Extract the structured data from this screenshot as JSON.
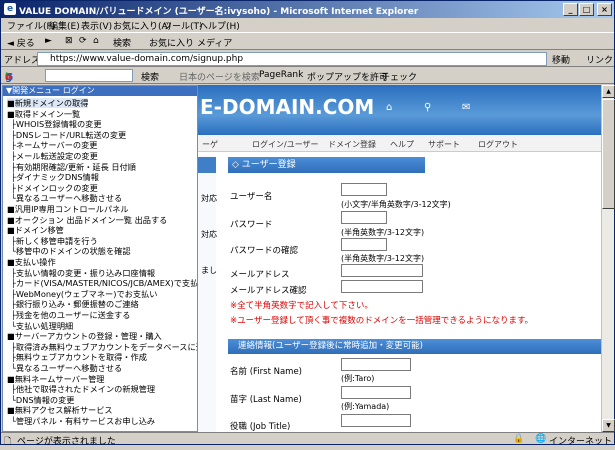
{
  "window": {
    "title": "VALUE DOMAIN/バリュードメイン (ユーザー名:ivysoho) - Microsoft Internet Explorer",
    "buttons": [
      "_",
      "□",
      "×"
    ]
  },
  "menubar": [
    "ファイル(F)",
    "編集(E)",
    "表示(V)",
    "お気に入り(A)",
    "ツール(T)",
    "ヘルプ(H)"
  ],
  "toolbar": [
    "◄ 戻る",
    "►",
    "⊠",
    "⟳",
    "⌂",
    "検索",
    "お気に入り",
    "メディア"
  ],
  "address": {
    "label": "アドレス(D)",
    "url": "https://www.value-domain.com/signup.php",
    "go": "移動",
    "links": "リンク"
  },
  "googlebar": {
    "logo": "Google -",
    "search": "検索",
    "items": [
      "日本のページを検索",
      "PageRank",
      "ポップアップを許可",
      "チェック"
    ]
  },
  "site": {
    "brand": "E-DOMAIN.COM",
    "nav": [
      "ログイン/ユーザー",
      "ドメイン登録",
      "ヘルプ",
      "サポート",
      "ログアウト"
    ],
    "nav_partial": "ーゲ",
    "strip_fragments": [
      "対応",
      "対応",
      "まし"
    ]
  },
  "form": {
    "section_title": "◇ ユーザー登録",
    "fields": [
      {
        "label": "ユーザー名",
        "hint": "(小文字/半角英数字/3-12文字)"
      },
      {
        "label": "パスワード",
        "hint": "(半角英数字/3-12文字)"
      },
      {
        "label": "パスワードの確認",
        "hint": "(半角英数字/3-12文字)"
      },
      {
        "label": "メールアドレス",
        "hint": ""
      },
      {
        "label": "メールアドレス確認",
        "hint": ""
      }
    ],
    "notes": [
      "※全て半角英数字で記入して下さい。",
      "※ユーザー登録して頂く事で複数のドメインを一括管理できるようになります。"
    ],
    "contact_title": "連絡情報(ユーザー登録後に常時追加・変更可能)",
    "contact_fields": [
      {
        "label": "名前 (First Name)",
        "hint": "(例:Taro)"
      },
      {
        "label": "苗字 (Last Name)",
        "hint": "(例:Yamada)"
      },
      {
        "label": "役職 (Job Title)",
        "hint": ""
      }
    ]
  },
  "menu": {
    "header": "▼開発メニュー ログイン",
    "items": [
      {
        "text": "■新規ドメインの取得",
        "sub": false
      },
      {
        "text": "■取得ドメイン一覧",
        "sub": false
      },
      {
        "text": "├WHOIS登録情報の変更",
        "sub": true
      },
      {
        "text": "├DNSレコード/URL転送の変更",
        "sub": true
      },
      {
        "text": "├ネームサーバーの変更",
        "sub": true
      },
      {
        "text": "├メール転送設定の変更",
        "sub": true
      },
      {
        "text": "├有効期限確認/更新・延長 日付順",
        "sub": true
      },
      {
        "text": "├ダイナミックDNS情報",
        "sub": true
      },
      {
        "text": "├ドメインロックの変更",
        "sub": true
      },
      {
        "text": "└異なるユーザーへ移動させる",
        "sub": true
      },
      {
        "text": "■汎用IP専用コントロールパネル",
        "sub": false
      },
      {
        "text": "■オークション 出品ドメイン一覧 出品する",
        "sub": false
      },
      {
        "text": "■ドメイン移管",
        "sub": false
      },
      {
        "text": "├新しく移管申請を行う",
        "sub": true
      },
      {
        "text": "└移管中のドメインの状態を確認",
        "sub": true
      },
      {
        "text": "■支払い操作",
        "sub": false
      },
      {
        "text": "├支払い情報の変更・振り込み口座情報",
        "sub": true
      },
      {
        "text": "├カード(VISA/MASTER/NICOS/JCB/AMEX)で支払い",
        "sub": true
      },
      {
        "text": "├WebMoney(ウェブマネー)でお支払い",
        "sub": true
      },
      {
        "text": "├銀行振り込み・郵便振替のご連絡",
        "sub": true
      },
      {
        "text": "├残金を他のユーザーに送金する",
        "sub": true
      },
      {
        "text": "└支払い処理明細",
        "sub": true
      },
      {
        "text": "■サーバーアカウントの登録・管理・購入",
        "sub": false
      },
      {
        "text": "├取得済み無料ウェブアカウントをデータベースに追加",
        "sub": true
      },
      {
        "text": "├無料ウェブアカウントを取得・作成",
        "sub": true
      },
      {
        "text": "└異なるユーザーへ移動させる",
        "sub": true
      },
      {
        "text": "■無料ネームサーバー管理",
        "sub": false
      },
      {
        "text": "├他社で取得されたドメインの新規管理",
        "sub": true
      },
      {
        "text": "└DNS情報の変更",
        "sub": true
      },
      {
        "text": "■無料アクセス解析サービス",
        "sub": false
      },
      {
        "text": "└管理パネル・有料サービスお申し込み",
        "sub": true
      }
    ]
  },
  "status": {
    "text": "ページが表示されました",
    "zone": "インターネット"
  }
}
